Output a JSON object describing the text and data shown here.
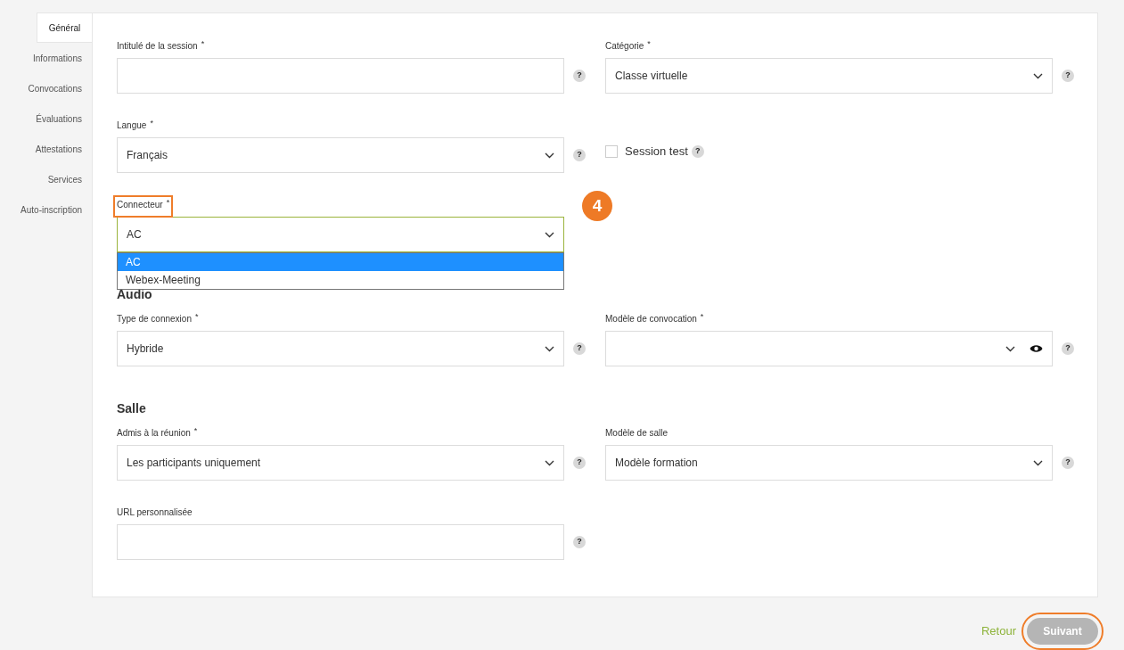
{
  "nav": [
    {
      "label": "Général",
      "selected": true
    },
    {
      "label": "Informations",
      "selected": false
    },
    {
      "label": "Convocations",
      "selected": false
    },
    {
      "label": "Évaluations",
      "selected": false
    },
    {
      "label": "Attestations",
      "selected": false
    },
    {
      "label": "Services",
      "selected": false
    },
    {
      "label": "Auto-inscription",
      "selected": false
    }
  ],
  "rows": [
    {
      "kind": "fields",
      "cells": [
        {
          "kind": "text",
          "label": "Intitulé de la session",
          "required": "*",
          "help": "?"
        },
        {
          "kind": "select",
          "label": "Catégorie",
          "required": "*",
          "value": "Classe virtuelle",
          "help": "?"
        }
      ]
    },
    {
      "kind": "fields",
      "cells": [
        {
          "kind": "select",
          "label": "Langue",
          "required": "*",
          "value": "Français",
          "help": "?"
        },
        {
          "kind": "checkbox",
          "label": "Session test",
          "checked": false,
          "help": "?"
        }
      ]
    },
    {
      "kind": "fields",
      "cells": [
        {
          "kind": "select",
          "label": "Connecteur",
          "required": "*",
          "value": "AC",
          "highlighted": true,
          "expanded": true,
          "options": [
            {
              "label": "AC",
              "selected": true
            },
            {
              "label": "Webex-Meeting",
              "selected": false
            }
          ]
        },
        {
          "kind": "badge",
          "label": "4"
        }
      ]
    },
    {
      "kind": "heading",
      "label": "Audio"
    },
    {
      "kind": "fields",
      "cells": [
        {
          "kind": "select",
          "label": "Type de connexion",
          "required": "*",
          "value": "Hybride",
          "help": "?"
        },
        {
          "kind": "select",
          "label": "Modèle de convocation",
          "required": "*",
          "preview": true,
          "help": "?"
        }
      ]
    },
    {
      "kind": "heading",
      "label": "Salle"
    },
    {
      "kind": "fields",
      "cells": [
        {
          "kind": "select",
          "label": "Admis à la réunion",
          "required": "*",
          "value": "Les participants uniquement",
          "help": "?"
        },
        {
          "kind": "select",
          "label": "Modèle de salle",
          "value": "Modèle formation",
          "help": "?"
        }
      ]
    },
    {
      "kind": "fields",
      "cells": [
        {
          "kind": "text",
          "label": "URL personnalisée",
          "help": "?"
        }
      ]
    }
  ],
  "footer": {
    "back": "Retour",
    "next": {
      "label": "Suivant",
      "disabled": true,
      "highlighted": true
    }
  }
}
